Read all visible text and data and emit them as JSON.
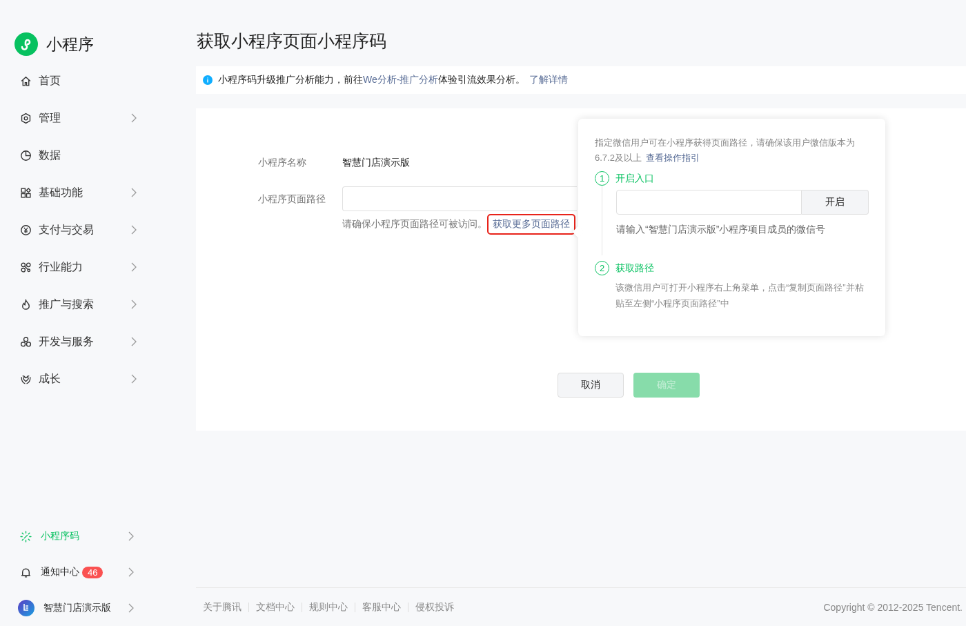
{
  "sidebar": {
    "logo_text": "小程序",
    "items": [
      {
        "label": "首页",
        "has_arrow": false,
        "selected": false
      },
      {
        "label": "管理",
        "has_arrow": true,
        "selected": false
      },
      {
        "label": "数据",
        "has_arrow": false,
        "selected": false
      },
      {
        "label": "基础功能",
        "has_arrow": true,
        "selected": false
      },
      {
        "label": "支付与交易",
        "has_arrow": true,
        "selected": false
      },
      {
        "label": "行业能力",
        "has_arrow": true,
        "selected": false
      },
      {
        "label": "推广与搜索",
        "has_arrow": true,
        "selected": false
      },
      {
        "label": "开发与服务",
        "has_arrow": true,
        "selected": false
      },
      {
        "label": "成长",
        "has_arrow": true,
        "selected": false
      }
    ],
    "bottom_items": [
      {
        "label": "小程序码",
        "has_arrow": true,
        "selected": true
      },
      {
        "label": "通知中心",
        "badge": "46",
        "has_arrow": true,
        "selected": false
      },
      {
        "label": "智慧门店演示版",
        "has_arrow": true,
        "selected": false
      }
    ]
  },
  "page": {
    "title": "获取小程序页面小程序码"
  },
  "notice": {
    "text_1": "小程序码升级推广分析能力，前往",
    "link_1": "We分析-推广分析",
    "text_2": "体验引流效果分析。",
    "link_2": "了解详情"
  },
  "form": {
    "name_label": "小程序名称",
    "name_value": "智慧门店演示版",
    "path_label": "小程序页面路径",
    "path_hint": "请确保小程序页面路径可被访问。",
    "path_link": "获取更多页面路径",
    "path_link_highlighted": true
  },
  "popover": {
    "intro": "指定微信用户可在小程序获得页面路径，请确保该用户微信版本为6.7.2及以上",
    "intro_link": "查看操作指引",
    "steps": [
      {
        "kind": "input",
        "number": "1",
        "title": "开启入口",
        "button": "开启",
        "description": "请输入“智慧门店演示版”小程序项目成员的微信号"
      },
      {
        "kind": "text",
        "number": "2",
        "title": "获取路径",
        "description": "该微信用户可打开小程序右上角菜单，点击“复制页面路径”并粘贴至左侧“小程序页面路径”中"
      }
    ]
  },
  "buttons": {
    "cancel": "取消",
    "confirm": "确定",
    "confirm_disabled": true
  },
  "footer": {
    "links": [
      "关于腾讯",
      "文档中心",
      "规则中心",
      "客服中心",
      "侵权投诉"
    ],
    "copyright": "Copyright © 2012-2025 Tencent."
  }
}
